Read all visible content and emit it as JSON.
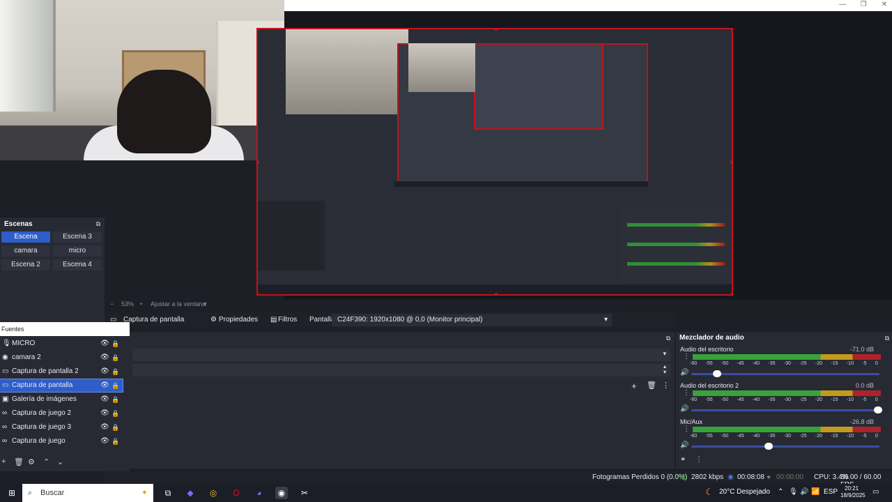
{
  "scenes": {
    "title": "Escenas",
    "items": [
      "Escena",
      "Escena 3",
      "camara",
      "micro",
      "Escena 2",
      "Escena 4"
    ],
    "active": "Escena"
  },
  "zoom": {
    "percent": "53%",
    "fit_label": "Ajustar a la ventana"
  },
  "source_toolbar": {
    "source_name": "Captura de pantalla",
    "properties_label": "Propiedades",
    "filters_label": "Filtros",
    "display_label": "Pantalla",
    "display_value": "C24F390: 1920x1080 @ 0,0 (Monitor principal)"
  },
  "sources": {
    "title": "Fuentes",
    "items": [
      {
        "name": "MICRO",
        "icon": "mic-icon"
      },
      {
        "name": "camara 2",
        "icon": "camera-icon"
      },
      {
        "name": "Captura de pantalla 2",
        "icon": "monitor-icon"
      },
      {
        "name": "Captura de pantalla",
        "icon": "monitor-icon",
        "selected": true
      },
      {
        "name": "Galería de imágenes",
        "icon": "slideshow-icon"
      },
      {
        "name": "Captura de juego 2",
        "icon": "gamepad-icon"
      },
      {
        "name": "Captura de juego 3",
        "icon": "gamepad-icon"
      },
      {
        "name": "Captura de juego",
        "icon": "gamepad-icon"
      }
    ]
  },
  "mixer": {
    "title": "Mezclador de audio",
    "ticks": [
      "-60",
      "-55",
      "-50",
      "-45",
      "-40",
      "-35",
      "-30",
      "-25",
      "-20",
      "-15",
      "-10",
      "-5",
      "0"
    ],
    "channels": [
      {
        "name": "Audio del escritorio",
        "db": "-71.0 dB",
        "volume": 0.12
      },
      {
        "name": "Audio del escritorio 2",
        "db": "0.0 dB",
        "volume": 1.0
      },
      {
        "name": "Mic/Aux",
        "db": "-26.8 dB",
        "volume": 0.4
      }
    ]
  },
  "status": {
    "dropped": "Fotogramas Perdidos 0 (0.0%)",
    "bitrate": "2802 kbps",
    "stream_time": "00:08:08",
    "rec_time": "00:00:00",
    "cpu": "CPU: 3.4%",
    "fps": "60.00 / 60.00 FPS"
  },
  "taskbar": {
    "search_placeholder": "Buscar",
    "weather": "20°C  Despejado",
    "lang": "ESP",
    "time": "20:21",
    "date": "18/9/2025"
  },
  "colors": {
    "accent": "#2f5dc9",
    "selection_border": "#c4121b",
    "panel": "#272a33"
  }
}
